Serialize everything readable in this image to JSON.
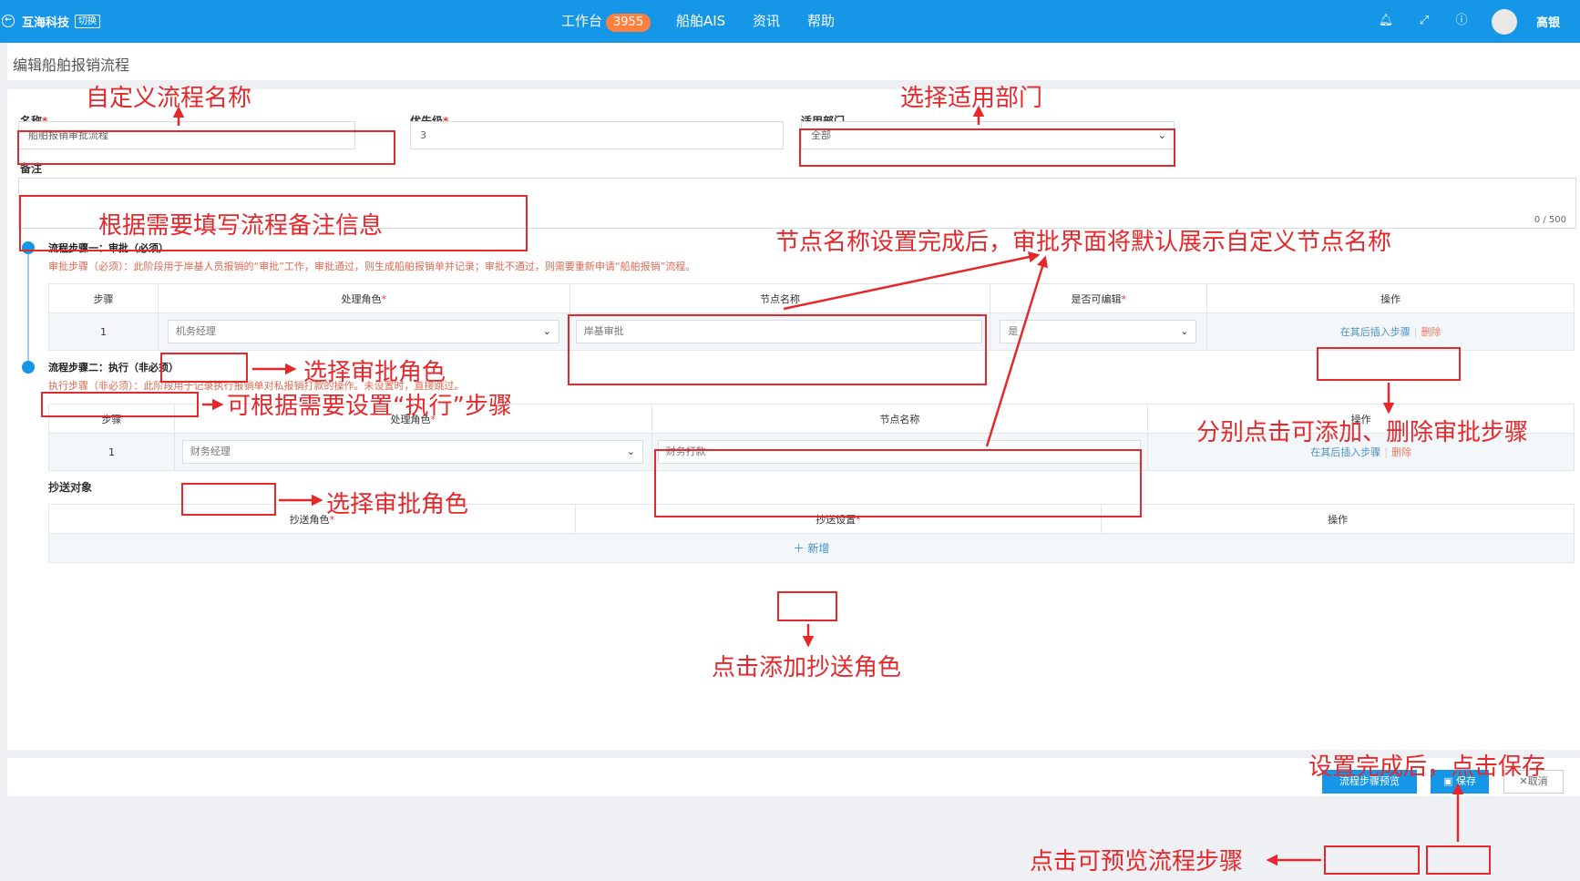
{
  "topbar": {
    "brand": "互海科技",
    "switch_label": "切换",
    "nav": [
      {
        "label": "工作台",
        "badge": "3955"
      },
      {
        "label": "船舶AIS"
      },
      {
        "label": "资讯"
      },
      {
        "label": "帮助"
      }
    ],
    "username": "高银"
  },
  "page": {
    "title": "编辑船舶报销流程"
  },
  "form": {
    "name_label": "名称",
    "name_value": "船舶报销审批流程",
    "priority_label": "优先级",
    "priority_value": "3",
    "dept_label": "适用部门",
    "dept_value": "全部",
    "remark_label": "备注",
    "remark_counter": "0 / 500",
    "required_mark": "*"
  },
  "step1": {
    "title": "流程步骤一：审批（必须）",
    "desc": "审批步骤（必须）：此阶段用于岸基人员报销的“审批”工作，审批通过，则生成船舶报销单并记录；审批不通过，则需要重新申请“船舶报销”流程。",
    "headers": [
      "步骤",
      "处理角色",
      "节点名称",
      "是否可编辑",
      "操作"
    ],
    "row": {
      "step": "1",
      "role": "机务经理",
      "node": "岸基审批",
      "editable": "是",
      "insert": "在其后插入步骤",
      "delete": "删除"
    }
  },
  "step2": {
    "title": "流程步骤二：执行（非必须）",
    "desc": "执行步骤（非必须）：此阶段用于记录执行报销单对私报销打款的操作。未设置时，直接跳过。",
    "headers": [
      "步骤",
      "处理角色",
      "节点名称",
      "操作"
    ],
    "row": {
      "step": "1",
      "role": "财务经理",
      "node": "财务打款",
      "insert": "在其后插入步骤",
      "delete": "删除"
    }
  },
  "cc": {
    "title": "抄送对象",
    "headers": [
      "抄送角色",
      "抄送设置",
      "操作"
    ],
    "add_label": "新增"
  },
  "footer": {
    "preview_label": "流程步骤预览",
    "save_label": "保存",
    "cancel_label": "取消"
  },
  "annotations": {
    "name": "自定义流程名称",
    "dept": "选择适用部门",
    "remark": "根据需要填写流程备注信息",
    "node_name": "节点名称设置完成后，审批界面将默认展示自定义节点名称",
    "role1": "选择审批角色",
    "step2": "可根据需要设置“执行”步骤",
    "add_delete": "分别点击可添加、删除审批步骤",
    "role2": "选择审批角色",
    "add_cc": "点击添加抄送角色",
    "save": "设置完成后，点击保存",
    "preview": "点击可预览流程步骤"
  },
  "colors": {
    "brand_blue": "#1596e6",
    "annotation_red": "#e5282b",
    "badge_orange": "#ff7f3f"
  }
}
